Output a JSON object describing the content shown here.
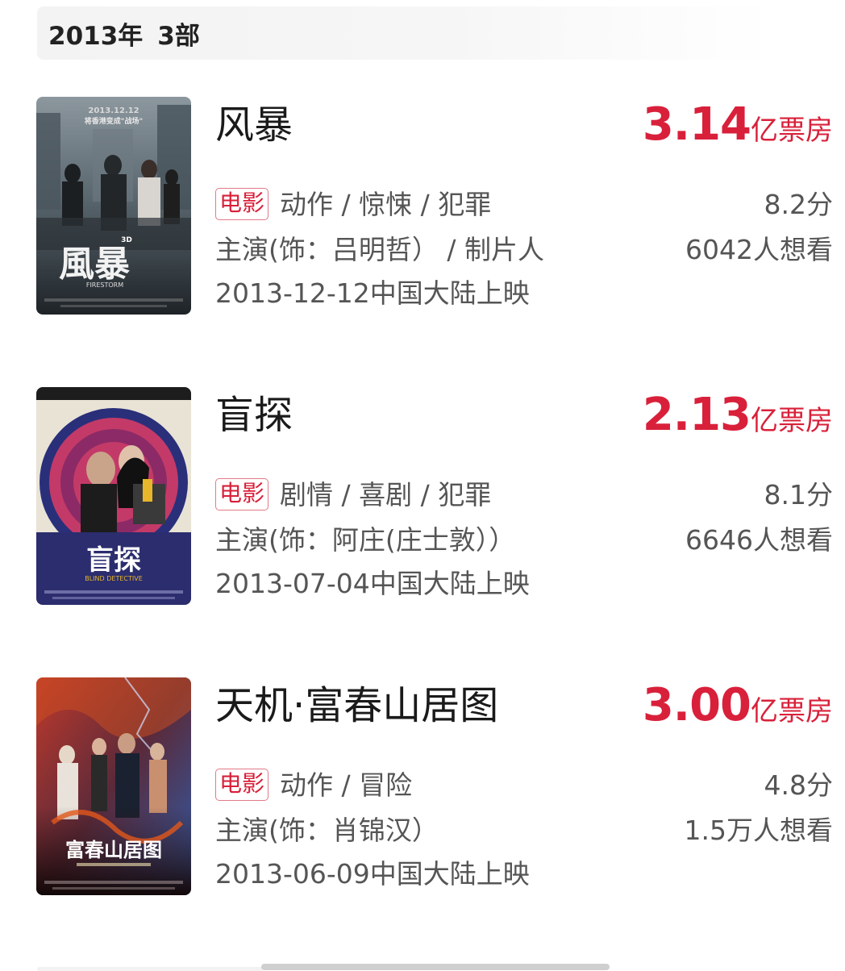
{
  "header": {
    "year": "2013年",
    "count": "3部"
  },
  "movies": [
    {
      "title": "风暴",
      "box_office_value": "3.14",
      "box_office_unit": "亿票房",
      "type_tag": "电影",
      "genres": "动作 / 惊悚 / 犯罪",
      "rating": "8.2分",
      "role": "主演(饰：吕明哲） / 制片人",
      "want_to_see": "6042人想看",
      "release": "2013-12-12中国大陆上映",
      "poster": {
        "top_text": "2013.12.12",
        "tagline": "将香港变成\"战场\"",
        "title_art": "風暴",
        "badge": "3D",
        "english": "FIRESTORM",
        "colors": [
          "#5b6870",
          "#2a3035",
          "#8a949b"
        ]
      }
    },
    {
      "title": "盲探",
      "box_office_value": "2.13",
      "box_office_unit": "亿票房",
      "type_tag": "电影",
      "genres": "剧情 / 喜剧 / 犯罪",
      "rating": "8.1分",
      "role": "主演(饰：阿庄(庄士敦））",
      "want_to_see": "6646人想看",
      "release": "2013-07-04中国大陆上映",
      "poster": {
        "title_art": "盲探",
        "english": "BLIND DETECTIVE",
        "colors": [
          "#2a2f7a",
          "#b02a5a",
          "#e9e3d6"
        ]
      }
    },
    {
      "title": "天机·富春山居图",
      "box_office_value": "3.00",
      "box_office_unit": "亿票房",
      "type_tag": "电影",
      "genres": "动作 / 冒险",
      "rating": "4.8分",
      "role": "主演(饰：肖锦汉）",
      "want_to_see": "1.5万人想看",
      "release": "2013-06-09中国大陆上映",
      "poster": {
        "title_art": "富春山居图",
        "colors": [
          "#2c5fb0",
          "#c0392b",
          "#1a1212"
        ]
      }
    }
  ]
}
